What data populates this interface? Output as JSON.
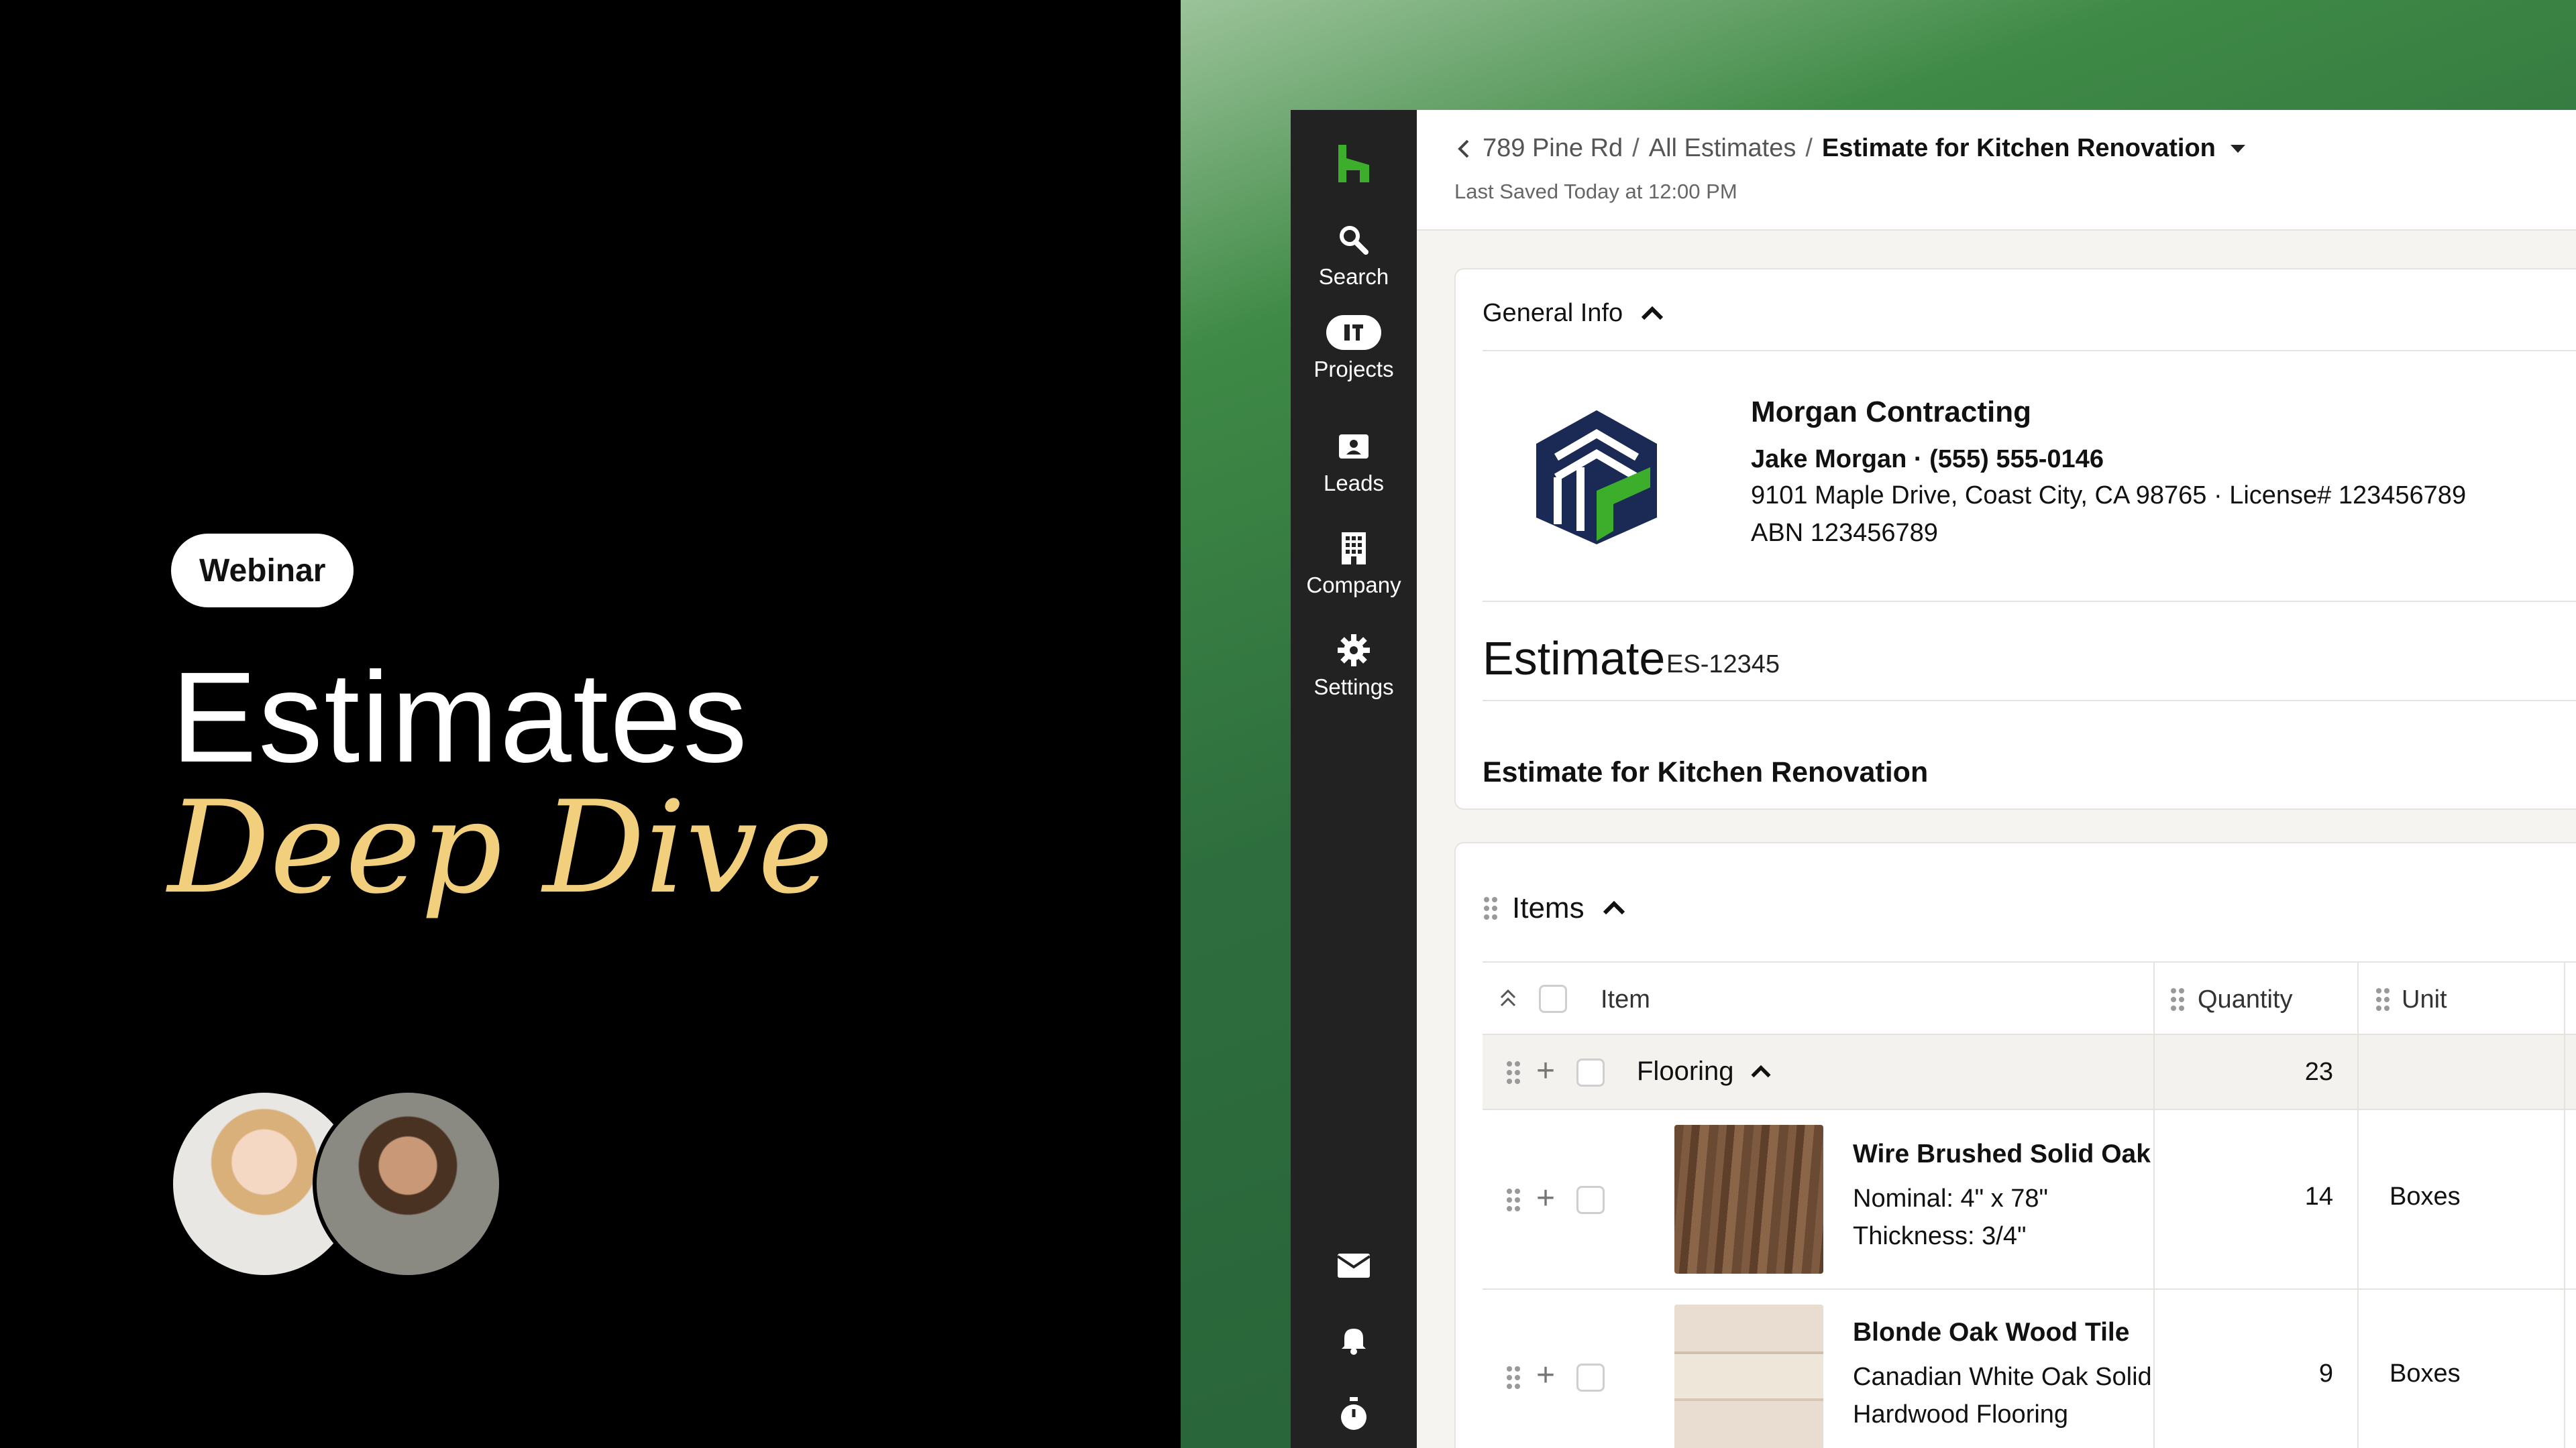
{
  "promo": {
    "badge": "Webinar",
    "title_line1": "Estimates",
    "title_line2": "Deep Dive"
  },
  "nav": {
    "items": [
      {
        "label": "Search",
        "icon": "search-icon"
      },
      {
        "label": "Projects",
        "icon": "projects-icon"
      },
      {
        "label": "Leads",
        "icon": "leads-icon"
      },
      {
        "label": "Company",
        "icon": "company-icon"
      },
      {
        "label": "Settings",
        "icon": "gear-icon"
      }
    ],
    "bottom_icons": [
      "mail-icon",
      "bell-icon",
      "timer-icon"
    ]
  },
  "header": {
    "breadcrumb": [
      "789 Pine Rd",
      "All Estimates",
      "Estimate for Kitchen Renovation"
    ],
    "last_saved": "Last Saved Today at 12:00 PM"
  },
  "general_info": {
    "section_title": "General Info",
    "company_name": "Morgan Contracting",
    "contact_name": "Jake Morgan",
    "phone": "(555) 555-0146",
    "address": "9101 Maple Drive, Coast City, CA 98765",
    "license": "License# 123456789",
    "abn": "ABN 123456789",
    "estimate_label": "Estimate",
    "estimate_number": "ES-12345",
    "estimate_title": "Estimate for Kitchen Renovation"
  },
  "items": {
    "section_title": "Items",
    "columns": {
      "item": "Item",
      "quantity": "Quantity",
      "unit": "Unit"
    },
    "group": {
      "name": "Flooring",
      "quantity": "23"
    },
    "rows": [
      {
        "name": "Wire Brushed Solid Oak",
        "desc1": "Nominal: 4\" x 78\"",
        "desc2": "Thickness: 3/4\"",
        "quantity": "14",
        "unit": "Boxes"
      },
      {
        "name": "Blonde Oak Wood Tile",
        "desc1": "Canadian White Oak Solid",
        "desc2": "Hardwood Flooring",
        "quantity": "9",
        "unit": "Boxes"
      }
    ]
  },
  "colors": {
    "brand_green": "#3dae2b",
    "nav_bg": "#222222",
    "promo_accent": "#f2cf7d",
    "logo_navy": "#1b2a55"
  }
}
